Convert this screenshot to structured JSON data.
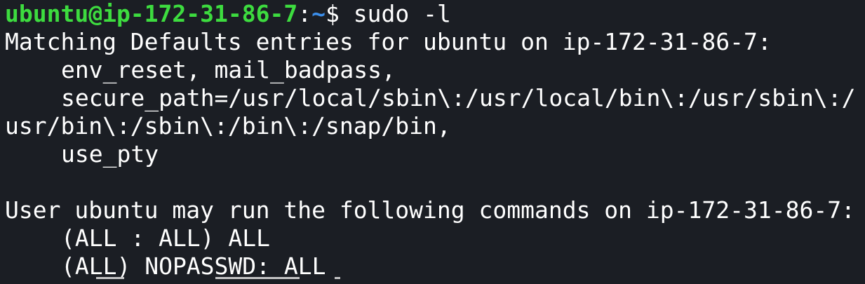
{
  "terminal": {
    "prompt": {
      "user_host": "ubuntu@ip-172-31-86-7",
      "separator": ":",
      "path": "~",
      "symbol": "$ ",
      "command": "sudo -l"
    },
    "lines": [
      "Matching Defaults entries for ubuntu on ip-172-31-86-7:",
      "env_reset, mail_badpass,",
      "secure_path=/usr/local/sbin\\:/usr/local/bin\\:/usr/sbin\\:/",
      "usr/bin\\:/sbin\\:/bin\\:/snap/bin,",
      "use_pty",
      "",
      "User ubuntu may run the following commands on ip-172-31-86-7:",
      "(ALL : ALL) ALL",
      "(ALL) NOPASSWD: ALL"
    ],
    "colors": {
      "background": "#1b1e24",
      "text": "#ffffff",
      "user_host": "#3ddc3f",
      "path": "#3b8eea"
    }
  }
}
